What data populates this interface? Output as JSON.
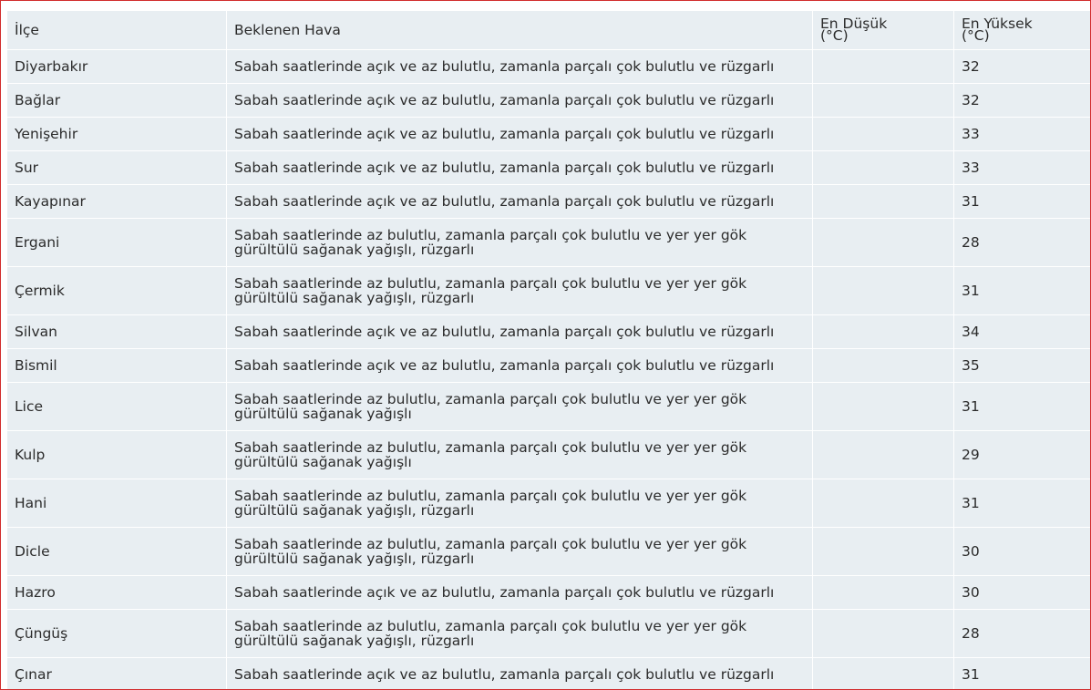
{
  "headers": {
    "district": "İlçe",
    "weather": "Beklenen Hava",
    "min_line1": "En Düşük",
    "min_line2": "(°C)",
    "max_line1": "En Yüksek",
    "max_line2": "(°C)"
  },
  "rows": [
    {
      "district": "Diyarbakır",
      "weather": "Sabah saatlerinde açık ve az bulutlu, zamanla parçalı çok bulutlu ve rüzgarlı",
      "min": "",
      "max": "32"
    },
    {
      "district": "Bağlar",
      "weather": "Sabah saatlerinde açık ve az bulutlu, zamanla parçalı çok bulutlu ve rüzgarlı",
      "min": "",
      "max": "32"
    },
    {
      "district": "Yenişehir",
      "weather": "Sabah saatlerinde açık ve az bulutlu, zamanla parçalı çok bulutlu ve rüzgarlı",
      "min": "",
      "max": "33"
    },
    {
      "district": "Sur",
      "weather": "Sabah saatlerinde açık ve az bulutlu, zamanla parçalı çok bulutlu ve rüzgarlı",
      "min": "",
      "max": "33"
    },
    {
      "district": "Kayapınar",
      "weather": "Sabah saatlerinde açık ve az bulutlu, zamanla parçalı çok bulutlu ve rüzgarlı",
      "min": "",
      "max": "31"
    },
    {
      "district": "Ergani",
      "weather": "Sabah saatlerinde az bulutlu, zamanla parçalı çok bulutlu ve yer yer gök gürültülü sağanak yağışlı, rüzgarlı",
      "min": "",
      "max": "28"
    },
    {
      "district": "Çermik",
      "weather": "Sabah saatlerinde az bulutlu, zamanla parçalı çok bulutlu ve yer yer gök gürültülü sağanak yağışlı, rüzgarlı",
      "min": "",
      "max": "31"
    },
    {
      "district": "Silvan",
      "weather": "Sabah saatlerinde açık ve az bulutlu, zamanla parçalı çok bulutlu ve rüzgarlı",
      "min": "",
      "max": "34"
    },
    {
      "district": "Bismil",
      "weather": "Sabah saatlerinde açık ve az bulutlu, zamanla parçalı çok bulutlu ve rüzgarlı",
      "min": "",
      "max": "35"
    },
    {
      "district": "Lice",
      "weather": "Sabah saatlerinde az bulutlu, zamanla parçalı çok bulutlu ve yer yer gök gürültülü sağanak yağışlı",
      "min": "",
      "max": "31"
    },
    {
      "district": "Kulp",
      "weather": "Sabah saatlerinde az bulutlu, zamanla parçalı çok bulutlu ve yer yer gök gürültülü sağanak yağışlı",
      "min": "",
      "max": "29"
    },
    {
      "district": "Hani",
      "weather": "Sabah saatlerinde az bulutlu, zamanla parçalı çok bulutlu ve yer yer gök gürültülü sağanak yağışlı, rüzgarlı",
      "min": "",
      "max": "31"
    },
    {
      "district": "Dicle",
      "weather": "Sabah saatlerinde az bulutlu, zamanla parçalı çok bulutlu ve yer yer gök gürültülü sağanak yağışlı, rüzgarlı",
      "min": "",
      "max": "30"
    },
    {
      "district": "Hazro",
      "weather": "Sabah saatlerinde açık ve az bulutlu, zamanla parçalı çok bulutlu ve rüzgarlı",
      "min": "",
      "max": "30"
    },
    {
      "district": "Çüngüş",
      "weather": "Sabah saatlerinde az bulutlu, zamanla parçalı çok bulutlu ve yer yer gök gürültülü sağanak yağışlı, rüzgarlı",
      "min": "",
      "max": "28"
    },
    {
      "district": "Çınar",
      "weather": "Sabah saatlerinde açık ve az bulutlu, zamanla parçalı çok bulutlu ve rüzgarlı",
      "min": "",
      "max": "31"
    }
  ],
  "colors": {
    "frame_border": "#d22d2d",
    "cell_bg": "#e8eef2",
    "max_temp": "#d23a3a"
  }
}
